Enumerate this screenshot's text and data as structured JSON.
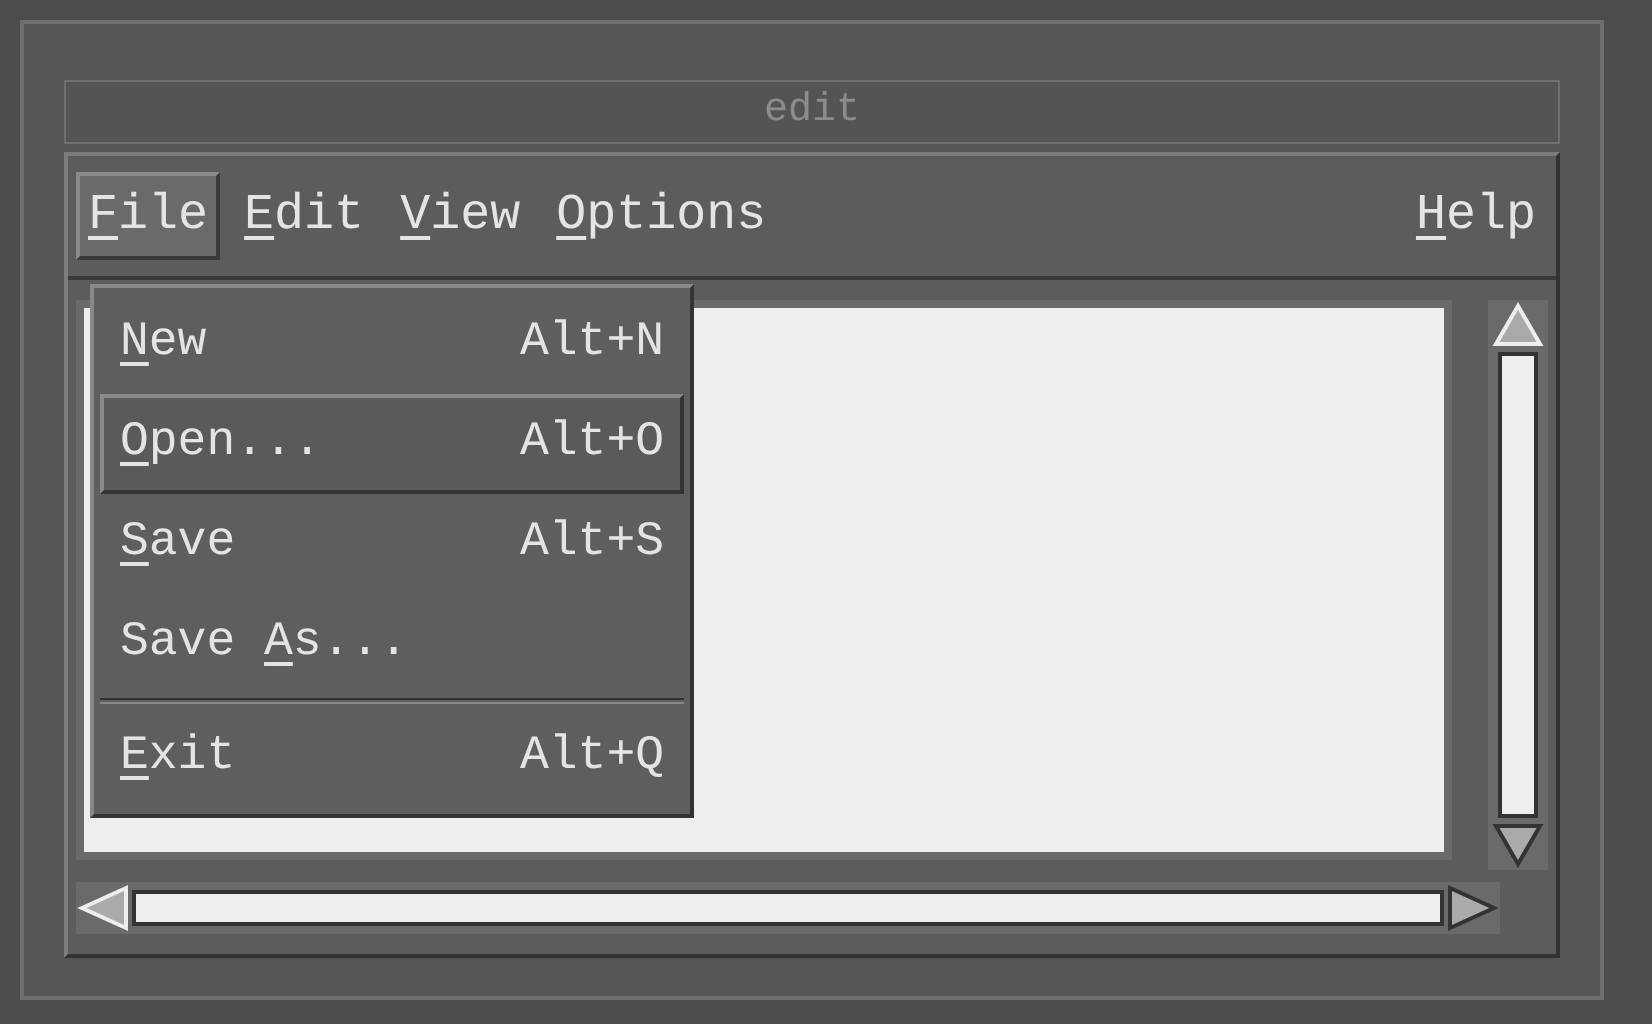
{
  "window": {
    "title": "edit"
  },
  "menubar": [
    {
      "key": "F",
      "post": "ile",
      "selected": true
    },
    {
      "key": "E",
      "post": "dit",
      "selected": false
    },
    {
      "key": "V",
      "post": "iew",
      "selected": false
    },
    {
      "key": "O",
      "post": "ptions",
      "selected": false
    },
    {
      "key": "H",
      "post": "elp",
      "selected": false
    }
  ],
  "file_menu": [
    {
      "kind": "item",
      "key": "N",
      "post": "ew",
      "shortcut": "Alt+N",
      "selected": false
    },
    {
      "kind": "item",
      "key": "O",
      "post": "pen...",
      "shortcut": "Alt+O",
      "selected": true
    },
    {
      "kind": "item",
      "key": "S",
      "post": "ave",
      "shortcut": "Alt+S",
      "selected": false
    },
    {
      "kind": "item",
      "pre": "Save ",
      "key": "A",
      "post": "s...",
      "selected": false
    },
    {
      "kind": "separator"
    },
    {
      "kind": "item",
      "key": "E",
      "post": "xit",
      "shortcut": "Alt+Q",
      "selected": false
    }
  ]
}
